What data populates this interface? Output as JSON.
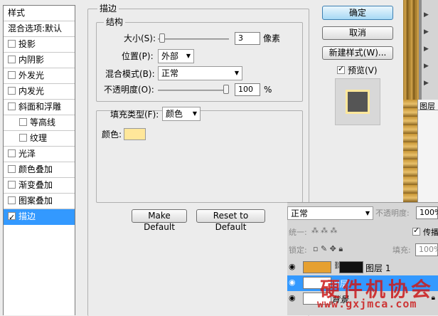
{
  "style_list": {
    "header": "样式",
    "blend_options": "混合选项:默认",
    "items": [
      {
        "label": "投影",
        "checked": false,
        "sub": false
      },
      {
        "label": "内阴影",
        "checked": false,
        "sub": false
      },
      {
        "label": "外发光",
        "checked": false,
        "sub": false
      },
      {
        "label": "内发光",
        "checked": false,
        "sub": false
      },
      {
        "label": "斜面和浮雕",
        "checked": false,
        "sub": false
      },
      {
        "label": "等高线",
        "checked": false,
        "sub": true
      },
      {
        "label": "纹理",
        "checked": false,
        "sub": true
      },
      {
        "label": "光泽",
        "checked": false,
        "sub": false
      },
      {
        "label": "颜色叠加",
        "checked": false,
        "sub": false
      },
      {
        "label": "渐变叠加",
        "checked": false,
        "sub": false
      },
      {
        "label": "图案叠加",
        "checked": false,
        "sub": false
      },
      {
        "label": "描边",
        "checked": true,
        "sub": false,
        "selected": true
      }
    ]
  },
  "stroke": {
    "title": "描边",
    "structure_title": "结构",
    "size_label": "大小(S):",
    "size_value": "3",
    "size_unit": "像素",
    "size_fraction": 0.02,
    "position_label": "位置(P):",
    "position_value": "外部",
    "blend_label": "混合模式(B):",
    "blend_value": "正常",
    "opacity_label": "不透明度(O):",
    "opacity_value": "100",
    "opacity_unit": "%",
    "opacity_fraction": 1.0,
    "fill_type_label": "填充类型(F):",
    "fill_type_value": "颜色",
    "color_label": "颜色:",
    "color": "#ffe79a",
    "make_default": "Make Default",
    "reset_default": "Reset to Default"
  },
  "buttons": {
    "ok": "确定",
    "cancel": "取消",
    "new_style": "新建样式(W)...",
    "preview_label": "预览(V)",
    "preview_checked": true
  },
  "layers": {
    "panel_title": "图层",
    "blend_mode": "正常",
    "opacity_label": "不透明度:",
    "opacity_value": "100%",
    "unify_label": "统一:",
    "propagate_label": "传播",
    "lock_label": "锁定:",
    "fill_label": "填充:",
    "fill_value": "100%",
    "rows": [
      {
        "name": "图层 1",
        "selected": false
      },
      {
        "name": "图层",
        "selected": true
      },
      {
        "name": "背景",
        "selected": false
      }
    ]
  },
  "watermark": {
    "cn": "硬件机协会",
    "url": "www.gxjmca.com"
  },
  "icons": {
    "eye": "eye-icon",
    "lock": "lock-icon",
    "link": "link-icon",
    "dropdown": "chevron-down-icon"
  }
}
